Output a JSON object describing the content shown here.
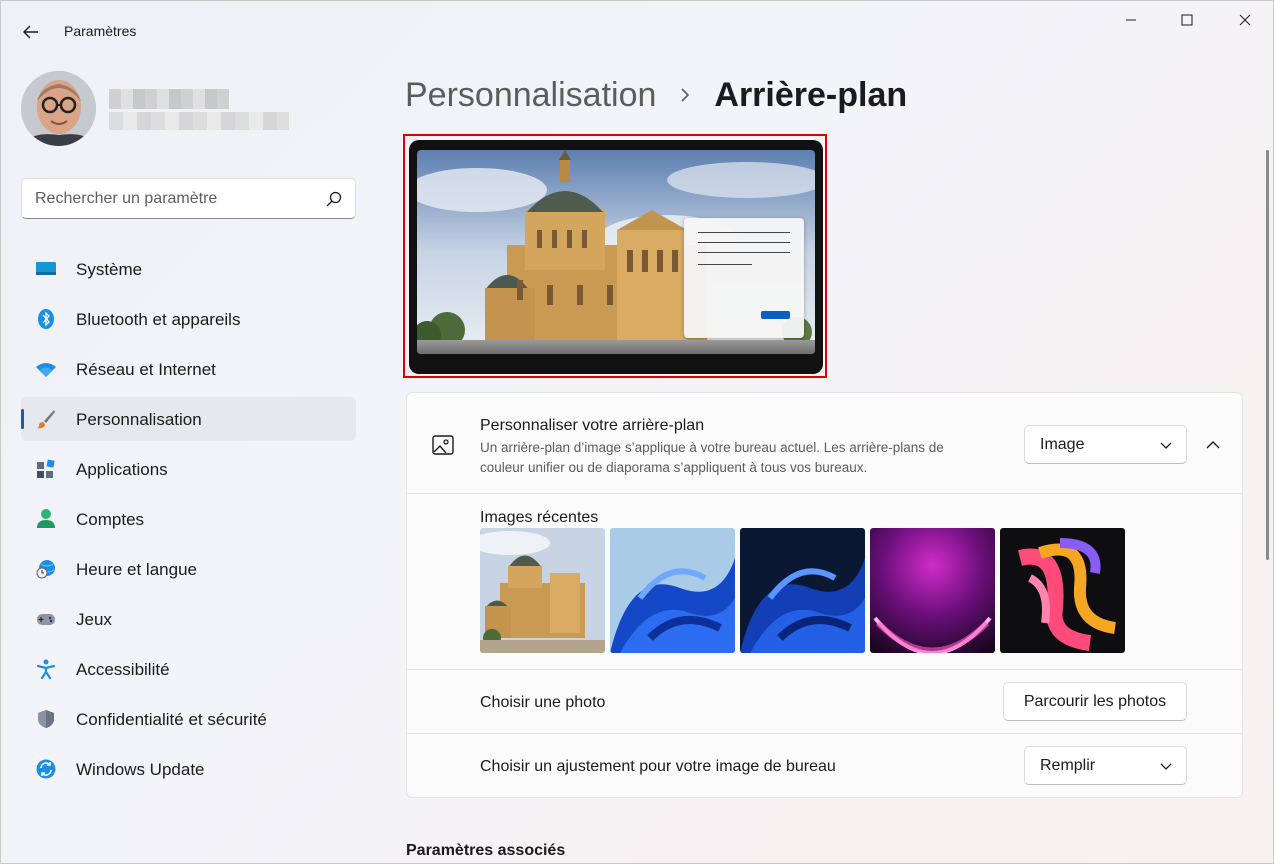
{
  "window": {
    "title": "Paramètres",
    "controls": [
      "minimize-icon",
      "maximize-icon",
      "close-icon"
    ]
  },
  "profile": {
    "name": "",
    "email": ""
  },
  "search": {
    "placeholder": "Rechercher un paramètre",
    "value": ""
  },
  "nav": {
    "items": [
      {
        "label": "Système",
        "icon": "system-icon"
      },
      {
        "label": "Bluetooth et appareils",
        "icon": "bluetooth-icon"
      },
      {
        "label": "Réseau et Internet",
        "icon": "wifi-icon"
      },
      {
        "label": "Personnalisation",
        "icon": "brush-icon",
        "active": true
      },
      {
        "label": "Applications",
        "icon": "apps-icon"
      },
      {
        "label": "Comptes",
        "icon": "person-icon"
      },
      {
        "label": "Heure et langue",
        "icon": "clock-globe-icon"
      },
      {
        "label": "Jeux",
        "icon": "gamepad-icon"
      },
      {
        "label": "Accessibilité",
        "icon": "accessibility-icon"
      },
      {
        "label": "Confidentialité et sécurité",
        "icon": "shield-icon"
      },
      {
        "label": "Windows Update",
        "icon": "update-icon"
      }
    ]
  },
  "header": {
    "parent": "Personnalisation",
    "current": "Arrière-plan"
  },
  "background": {
    "title": "Personnaliser votre arrière-plan",
    "description": "Un arrière-plan d’image s’applique à votre bureau actuel. Les arrière-plans de couleur unifier ou de diaporama s’appliquent à tous vos bureaux.",
    "type_value": "Image",
    "recent_label": "Images récentes",
    "recent_images": [
      "cathedral",
      "bloom-light",
      "bloom-dark",
      "purple-glow",
      "ribbons"
    ],
    "choose_photo_label": "Choisir une photo",
    "browse_label": "Parcourir les photos",
    "fit_label": "Choisir un ajustement pour votre image de bureau",
    "fit_value": "Remplir"
  },
  "related": {
    "title": "Paramètres associés"
  },
  "colors": {
    "accent": "#0a5fc2",
    "highlight": "#e00000"
  }
}
